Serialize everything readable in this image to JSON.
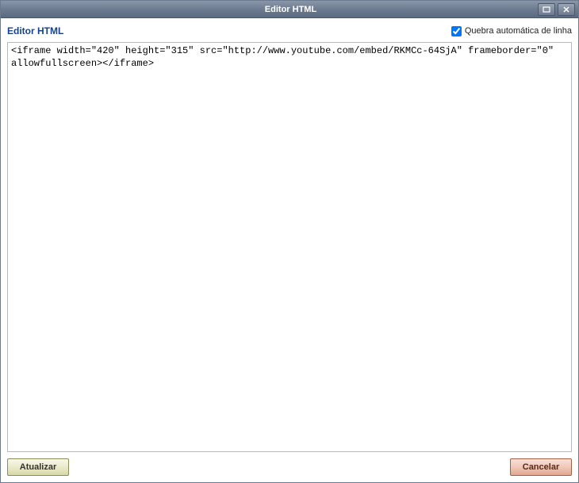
{
  "window": {
    "title": "Editor HTML"
  },
  "header": {
    "heading": "Editor HTML",
    "wrap_label": "Quebra automática de linha",
    "wrap_checked": true
  },
  "editor": {
    "content": "<iframe width=\"420\" height=\"315\" src=\"http://www.youtube.com/embed/RKMCc-64SjA\" frameborder=\"0\" allowfullscreen></iframe>"
  },
  "buttons": {
    "update": "Atualizar",
    "cancel": "Cancelar"
  }
}
